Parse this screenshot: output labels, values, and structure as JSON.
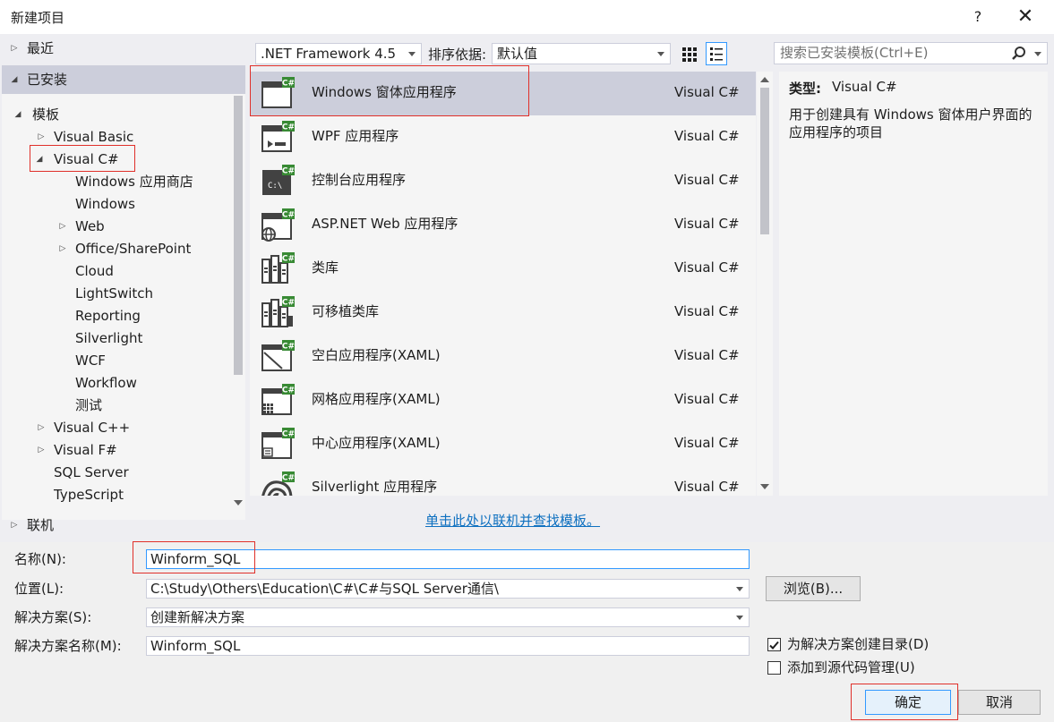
{
  "window": {
    "title": "新建项目",
    "help": "?",
    "close": "✕"
  },
  "left": {
    "recent": "最近",
    "installed": "已安装",
    "templates": "模板",
    "visual_basic": "Visual Basic",
    "visual_csharp": "Visual C#",
    "csharp_children": [
      "Windows 应用商店",
      "Windows",
      "Web",
      "Office/SharePoint",
      "Cloud",
      "LightSwitch",
      "Reporting",
      "Silverlight",
      "WCF",
      "Workflow",
      "测试"
    ],
    "visual_cpp": "Visual C++",
    "visual_fsharp": "Visual F#",
    "sql_server": "SQL Server",
    "typescript": "TypeScript",
    "online": "联机"
  },
  "toolbar": {
    "framework": ".NET Framework 4.5",
    "sort_label": "排序依据:",
    "sort_value": "默认值",
    "search_placeholder": "搜索已安装模板(Ctrl+E)"
  },
  "templates": [
    {
      "name": "Windows 窗体应用程序",
      "lang": "Visual C#",
      "icon": "windows-forms-icon",
      "selected": true
    },
    {
      "name": "WPF 应用程序",
      "lang": "Visual C#",
      "icon": "wpf-icon"
    },
    {
      "name": "控制台应用程序",
      "lang": "Visual C#",
      "icon": "console-icon"
    },
    {
      "name": "ASP.NET Web 应用程序",
      "lang": "Visual C#",
      "icon": "aspnet-globe-icon"
    },
    {
      "name": "类库",
      "lang": "Visual C#",
      "icon": "class-library-icon"
    },
    {
      "name": "可移植类库",
      "lang": "Visual C#",
      "icon": "portable-class-library-icon"
    },
    {
      "name": "空白应用程序(XAML)",
      "lang": "Visual C#",
      "icon": "blank-app-icon"
    },
    {
      "name": "网格应用程序(XAML)",
      "lang": "Visual C#",
      "icon": "grid-app-icon"
    },
    {
      "name": "中心应用程序(XAML)",
      "lang": "Visual C#",
      "icon": "hub-app-icon"
    },
    {
      "name": "Silverlight 应用程序",
      "lang": "Visual C#",
      "icon": "silverlight-icon"
    }
  ],
  "online_link": "单击此处以联机并查找模板。",
  "details": {
    "type_label": "类型:",
    "type_value": "Visual C#",
    "description": "用于创建具有 Windows 窗体用户界面的应用程序的项目"
  },
  "form": {
    "name_label": "名称(N):",
    "name_value": "Winform_SQL",
    "location_label": "位置(L):",
    "location_value": "C:\\Study\\Others\\Education\\C#\\C#与SQL Server通信\\",
    "browse": "浏览(B)...",
    "solution_label": "解决方案(S):",
    "solution_value": "创建新解决方案",
    "solution_name_label": "解决方案名称(M):",
    "solution_name_value": "Winform_SQL",
    "create_dir_label": "为解决方案创建目录(D)",
    "create_dir_checked": true,
    "add_source_label": "添加到源代码管理(U)",
    "add_source_checked": false,
    "ok": "确定",
    "cancel": "取消"
  },
  "colors": {
    "accent": "#3399ff",
    "highlight_box": "#e0302a",
    "link": "#0e70c0",
    "selected_row": "#cccedb",
    "csharp_badge": "#388a34"
  }
}
